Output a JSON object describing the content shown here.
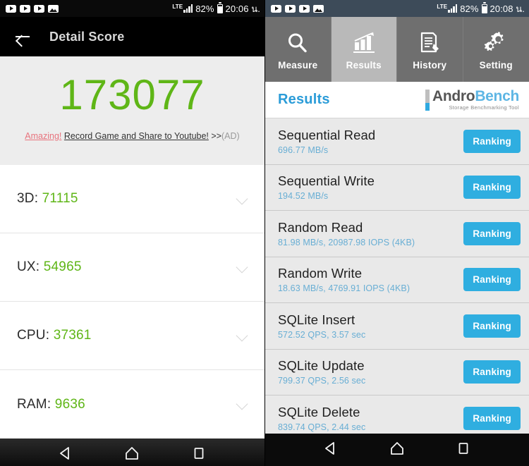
{
  "left": {
    "status_bar": {
      "icons": [
        "youtube-play-icon",
        "youtube-play-icon",
        "youtube-play-icon",
        "image-icon"
      ],
      "network": "LTE",
      "battery": "82%",
      "time": "20:06 น."
    },
    "appbar": {
      "back_icon": "back-arrow-icon",
      "title": "Detail Score"
    },
    "hero": {
      "total_score": "173077",
      "ad_amazing": "Amazing!",
      "ad_main": "Record Game and Share to Youtube!",
      "ad_arrows": ">>",
      "ad_tag": "(AD)"
    },
    "scores": [
      {
        "label": "3D:",
        "value": "71115",
        "chevron": "chevron-down-icon"
      },
      {
        "label": "UX:",
        "value": "54965",
        "chevron": "chevron-down-icon"
      },
      {
        "label": "CPU:",
        "value": "37361",
        "chevron": "chevron-down-icon"
      },
      {
        "label": "RAM:",
        "value": "9636",
        "chevron": "chevron-down-icon"
      }
    ],
    "navbar": {
      "back": "nav-back-icon",
      "home": "nav-home-icon",
      "recents": "nav-recents-icon"
    }
  },
  "right": {
    "status_bar": {
      "icons": [
        "youtube-play-icon",
        "youtube-play-icon",
        "youtube-play-icon",
        "image-icon"
      ],
      "network": "LTE",
      "battery": "82%",
      "time": "20:08 น."
    },
    "tabs": [
      {
        "label": "Measure",
        "icon": "magnifier-icon",
        "active": false
      },
      {
        "label": "Results",
        "icon": "bar-chart-icon",
        "active": true
      },
      {
        "label": "History",
        "icon": "document-edit-icon",
        "active": false
      },
      {
        "label": "Setting",
        "icon": "gears-icon",
        "active": false
      }
    ],
    "header": {
      "title": "Results",
      "logo_andro": "Andro",
      "logo_bench": "Bench",
      "logo_sub": "Storage Benchmarking Tool"
    },
    "results": [
      {
        "name": "Sequential Read",
        "value": "696.77 MB/s",
        "button": "Ranking"
      },
      {
        "name": "Sequential Write",
        "value": "194.52 MB/s",
        "button": "Ranking"
      },
      {
        "name": "Random Read",
        "value": "81.98 MB/s, 20987.98 IOPS (4KB)",
        "button": "Ranking"
      },
      {
        "name": "Random Write",
        "value": "18.63 MB/s, 4769.91 IOPS (4KB)",
        "button": "Ranking"
      },
      {
        "name": "SQLite Insert",
        "value": "572.52 QPS, 3.57 sec",
        "button": "Ranking"
      },
      {
        "name": "SQLite Update",
        "value": "799.37 QPS, 2.56 sec",
        "button": "Ranking"
      },
      {
        "name": "SQLite Delete",
        "value": "839.74 QPS, 2.44 sec",
        "button": "Ranking"
      }
    ],
    "navbar": {
      "back": "nav-back-icon",
      "home": "nav-home-icon",
      "recents": "nav-recents-icon"
    }
  },
  "colors": {
    "score_green": "#5fb617",
    "accent_blue": "#2faee0",
    "ad_red": "#e8737d",
    "tab_gray": "#6f6f6f",
    "tab_active": "#b9b9b9"
  }
}
